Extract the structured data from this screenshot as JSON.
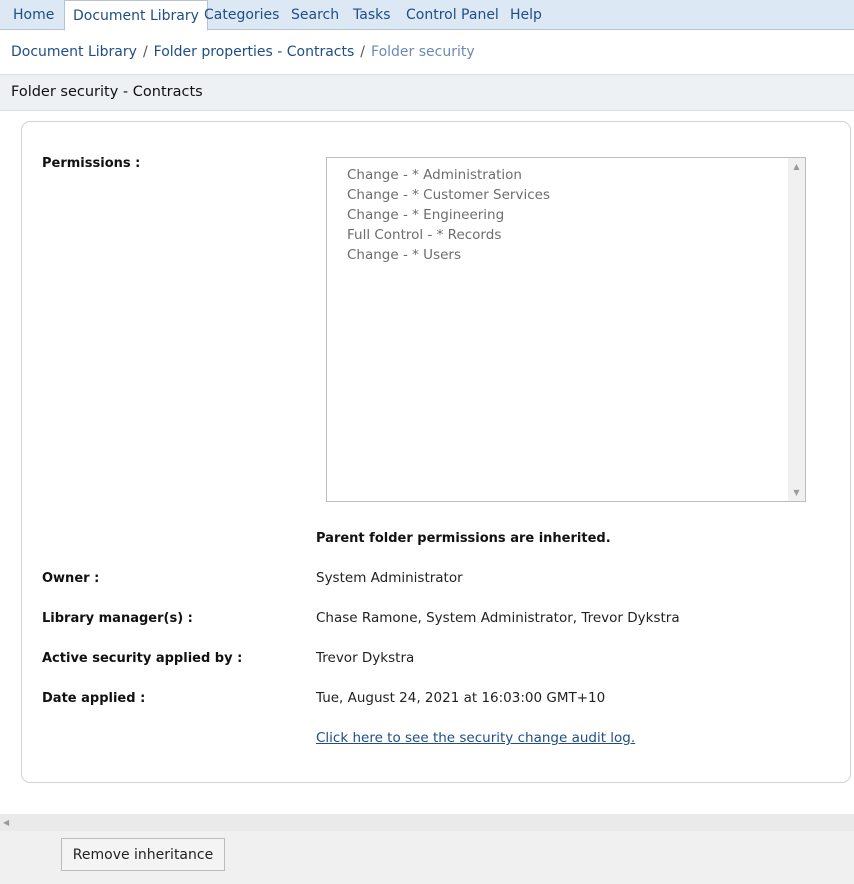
{
  "nav": {
    "tabs": [
      {
        "label": "Home"
      },
      {
        "label": "Document Library"
      },
      {
        "label": "Categories"
      },
      {
        "label": "Search"
      },
      {
        "label": "Tasks"
      },
      {
        "label": "Control Panel"
      },
      {
        "label": "Help"
      }
    ],
    "active_tab": "Document Library"
  },
  "breadcrumb": {
    "items": [
      "Document Library",
      "Folder properties - Contracts",
      "Folder security"
    ],
    "separator": "/"
  },
  "page": {
    "title": "Folder security - Contracts"
  },
  "form": {
    "permissions_label": "Permissions :",
    "permissions": [
      "Change - * Administration",
      "Change - * Customer Services",
      "Change - * Engineering",
      "Full Control - * Records",
      "Change - * Users"
    ],
    "inherited_note": "Parent folder permissions are inherited.",
    "owner_label": "Owner :",
    "owner_value": "System Administrator",
    "managers_label": "Library manager(s) :",
    "managers_value": "Chase Ramone, System Administrator, Trevor Dykstra",
    "applied_by_label": "Active security applied by :",
    "applied_by_value": "Trevor Dykstra",
    "date_label": "Date applied :",
    "date_value": "Tue, August 24, 2021 at 16:03:00 GMT+10",
    "audit_link": "Click here to see the security change audit log."
  },
  "footer": {
    "remove_button": "Remove inheritance"
  },
  "icons": {
    "scroll_up": "triangle-up-icon",
    "scroll_down": "triangle-down-icon",
    "scroll_left": "triangle-left-icon"
  },
  "colors": {
    "nav_bg": "#dde8f5",
    "link": "#1f4d86",
    "breadcrumb_current": "#6b8ab7",
    "title_bar_bg": "#eef1f4"
  }
}
